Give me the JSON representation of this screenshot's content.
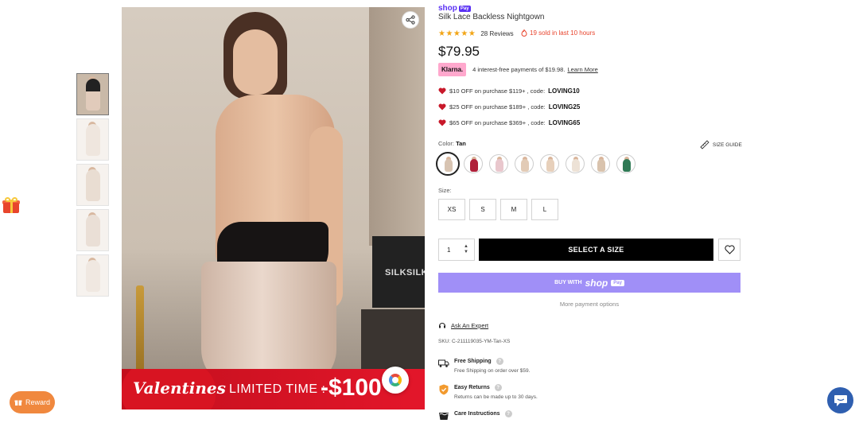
{
  "shoppay": {
    "brand": "shop",
    "pay": "Pay"
  },
  "product": {
    "title": "Silk Lace Backless Nightgown",
    "stars": "★★★★★",
    "reviews": "28 Reviews",
    "sold": "19 sold in last 10 hours",
    "price": "$79.95"
  },
  "klarna": {
    "badge": "Klarna.",
    "text": "4 interest-free payments of $19.98.",
    "learn_more": "Learn More"
  },
  "coupons": [
    {
      "text": "$10 OFF on purchase $119+ ,  code:",
      "code": "LOVING10"
    },
    {
      "text": "$25 OFF on purchase $189+ ,  code:",
      "code": "LOVING25"
    },
    {
      "text": "$65 OFF on purchase $369+ ,  code:",
      "code": "LOVING65"
    }
  ],
  "color": {
    "label": "Color:",
    "value": "Tan",
    "size_guide": "SIZE GUIDE"
  },
  "swatches": [
    {
      "name": "Tan",
      "color": "#d8c4b2"
    },
    {
      "name": "Red",
      "color": "#b0203a"
    },
    {
      "name": "Blush",
      "color": "#e9c7cd"
    },
    {
      "name": "Champagne",
      "color": "#e2cbb6"
    },
    {
      "name": "Nude",
      "color": "#e7d0bb"
    },
    {
      "name": "Ivory",
      "color": "#ede2d6"
    },
    {
      "name": "Beige",
      "color": "#d9c3ad"
    },
    {
      "name": "Green",
      "color": "#2f7a55"
    }
  ],
  "size": {
    "label": "Size:",
    "options": [
      "XS",
      "S",
      "M",
      "L"
    ]
  },
  "quantity": {
    "value": "1"
  },
  "actions": {
    "select_size": "SELECT A SIZE",
    "buy_with": "BUY WITH",
    "shop": "shop",
    "pay": "Pay",
    "more_payment": "More payment options"
  },
  "expert": {
    "label": "Ask An Expert"
  },
  "sku": "SKU: C-211119035-YM-Tan-XS",
  "features": [
    {
      "title": "Free Shipping",
      "desc": "Free Shipping on order over $59."
    },
    {
      "title": "Easy Returns",
      "desc": "Returns can be made up to 30 days."
    },
    {
      "title": "Care Instructions",
      "desc": ""
    }
  ],
  "image": {
    "brand_box": "SILKSILKY",
    "banner_vday": "Valentines",
    "banner_limited": "LIMITED TIME :",
    "banner_amount": "-$100"
  },
  "reward": {
    "label": "Reward"
  },
  "colors": {
    "accent": "#5a31f4",
    "shop_button": "#a08ff7",
    "star": "#f2a516",
    "sold": "#e8442d",
    "reward": "#f0883e",
    "chat": "#2f5fb0"
  }
}
